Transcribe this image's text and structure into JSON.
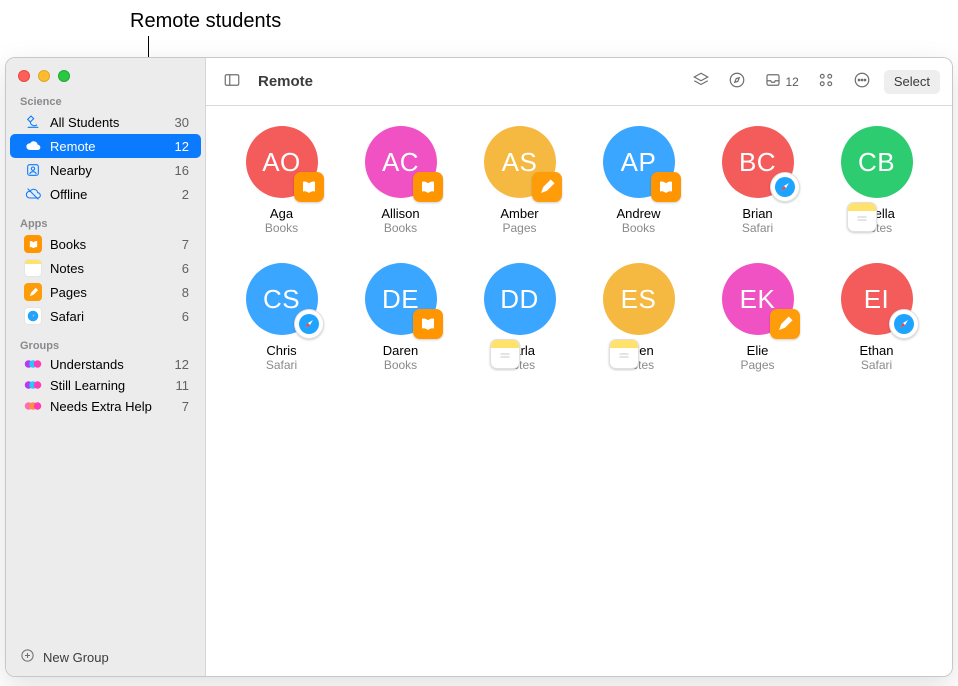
{
  "annotation": {
    "label": "Remote students"
  },
  "header": {
    "title": "Remote",
    "inbox_count": "12",
    "select_label": "Select"
  },
  "sidebar": {
    "sections": {
      "science": {
        "heading": "Science",
        "items": [
          {
            "key": "all-students",
            "label": "All Students",
            "count": "30"
          },
          {
            "key": "remote",
            "label": "Remote",
            "count": "12",
            "selected": true
          },
          {
            "key": "nearby",
            "label": "Nearby",
            "count": "16"
          },
          {
            "key": "offline",
            "label": "Offline",
            "count": "2"
          }
        ]
      },
      "apps": {
        "heading": "Apps",
        "items": [
          {
            "key": "books",
            "label": "Books",
            "count": "7"
          },
          {
            "key": "notes",
            "label": "Notes",
            "count": "6"
          },
          {
            "key": "pages",
            "label": "Pages",
            "count": "8"
          },
          {
            "key": "safari",
            "label": "Safari",
            "count": "6"
          }
        ]
      },
      "groups": {
        "heading": "Groups",
        "items": [
          {
            "key": "understands",
            "label": "Understands",
            "count": "12"
          },
          {
            "key": "still-learning",
            "label": "Still Learning",
            "count": "11"
          },
          {
            "key": "needs-extra-help",
            "label": "Needs Extra Help",
            "count": "7"
          }
        ]
      }
    },
    "new_group_label": "New Group"
  },
  "students": [
    {
      "initials": "AO",
      "name": "Aga",
      "app": "Books",
      "color": "#f45b5b"
    },
    {
      "initials": "AC",
      "name": "Allison",
      "app": "Books",
      "color": "#f152c3"
    },
    {
      "initials": "AS",
      "name": "Amber",
      "app": "Pages",
      "color": "#f5b942"
    },
    {
      "initials": "AP",
      "name": "Andrew",
      "app": "Books",
      "color": "#3ba6ff"
    },
    {
      "initials": "BC",
      "name": "Brian",
      "app": "Safari",
      "color": "#f45b5b"
    },
    {
      "initials": "CB",
      "name": "Chella",
      "app": "Notes",
      "color": "#2ecc71"
    },
    {
      "initials": "CS",
      "name": "Chris",
      "app": "Safari",
      "color": "#3ba6ff"
    },
    {
      "initials": "DE",
      "name": "Daren",
      "app": "Books",
      "color": "#3ba6ff"
    },
    {
      "initials": "DD",
      "name": "Darla",
      "app": "Notes",
      "color": "#3ba6ff"
    },
    {
      "initials": "ES",
      "name": "Eden",
      "app": "Notes",
      "color": "#f5b942"
    },
    {
      "initials": "EK",
      "name": "Elie",
      "app": "Pages",
      "color": "#f152c3"
    },
    {
      "initials": "EI",
      "name": "Ethan",
      "app": "Safari",
      "color": "#f45b5b"
    }
  ]
}
